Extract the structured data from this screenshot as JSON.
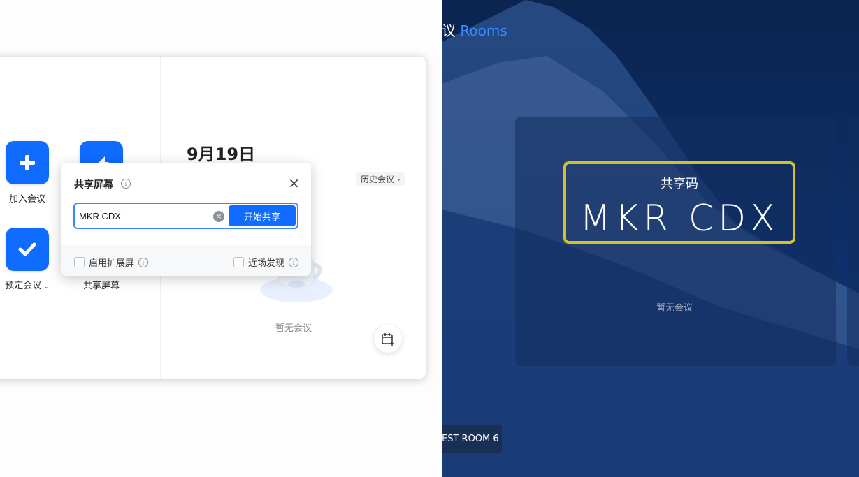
{
  "app": {
    "actions": [
      {
        "label": "加入会议",
        "icon": "plus-icon"
      },
      {
        "label": "",
        "icon": "share-arrow-icon"
      },
      {
        "label": "预定会议",
        "icon": "check-icon"
      },
      {
        "label": "共享屏幕",
        "icon": "share-screen-icon"
      }
    ],
    "date": "9月19日",
    "history_label": "历史会议",
    "empty_text": "暂无会议"
  },
  "dialog": {
    "title": "共享屏幕",
    "input_value": "MKR CDX",
    "start_button": "开始共享",
    "extend_label": "启用扩展屏",
    "nearby_label": "近场发现"
  },
  "rooms": {
    "brand_prefix": "议",
    "brand_suffix": "Rooms",
    "share_code_label": "共享码",
    "share_code": "MKR CDX",
    "empty_text": "暂无会议",
    "room_name": "EST ROOM 6",
    "colors": {
      "accent": "#3b8cff",
      "code_frame": "#d3c02a",
      "primary_button": "#0f6cff"
    }
  }
}
